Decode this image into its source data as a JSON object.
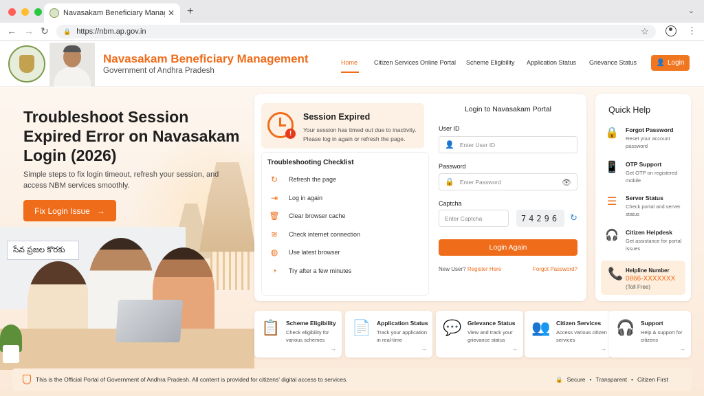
{
  "browser": {
    "tab_title": "Navasakam Beneficiary Management",
    "tab_close": "✕",
    "new_tab": "+",
    "url": "https://nbm.ap.gov.in"
  },
  "header": {
    "title": "Navasakam Beneficiary Management",
    "subtitle": "Government of Andhra Pradesh",
    "nav": [
      "Home",
      "Citizen Services Online Portal",
      "Scheme Eligibility",
      "Application Status",
      "Grievance Status"
    ],
    "login_label": "Login"
  },
  "hero": {
    "title": "Troubleshoot Session Expired Error on Navasakam Login (2026)",
    "subtitle": "Simple steps to fix login timeout, refresh your session, and access NBM services smoothly.",
    "cta_label": "Fix Login Issue",
    "sign_text": "సేవ ప్రజల కొరకు"
  },
  "expired": {
    "title": "Session Expired",
    "message": "Your session has timed out due to inactivity. Please log in again or refresh the page.",
    "badge": "!"
  },
  "checklist": {
    "title": "Troubleshooting Checklist",
    "items": [
      {
        "icon": "refresh-icon",
        "label": "Refresh the page"
      },
      {
        "icon": "login-icon",
        "label": "Log in again"
      },
      {
        "icon": "trash-icon",
        "label": "Clear browser cache"
      },
      {
        "icon": "wifi-icon",
        "label": "Check internet connection"
      },
      {
        "icon": "globe-icon",
        "label": "Use latest browser"
      },
      {
        "icon": "clock-icon",
        "label": "Try after a few minutes"
      }
    ]
  },
  "login_form": {
    "title": "Login to Navasakam Portal",
    "user_label": "User ID",
    "user_placeholder": "Enter User ID",
    "password_label": "Password",
    "password_placeholder": "Enter Password",
    "captcha_label": "Captcha",
    "captcha_placeholder": "Enter Captcha",
    "captcha_code": "74296",
    "submit_label": "Login Again",
    "new_user_text": "New User?",
    "register_label": "Register Here",
    "forgot_label": "Forgot Password?"
  },
  "quick_help": {
    "title": "Quick Help",
    "items": [
      {
        "title": "Forgot Password",
        "desc": "Reset your account password"
      },
      {
        "title": "OTP Support",
        "desc": "Get OTP on registered mobile"
      },
      {
        "title": "Server Status",
        "desc": "Check portal and server status"
      },
      {
        "title": "Citizen Helpdesk",
        "desc": "Get assistance for portal issues"
      }
    ],
    "helpline_label": "Helpline Number",
    "helpline_number": "0866-XXXXXXX",
    "helpline_note": "(Toll Free)"
  },
  "services": [
    {
      "title": "Scheme Eligibility",
      "desc": "Check eligibility for various schemes"
    },
    {
      "title": "Application Status",
      "desc": "Track your application in real-time"
    },
    {
      "title": "Grievance Status",
      "desc": "View and track your grievance status"
    },
    {
      "title": "Citizen Services",
      "desc": "Access various citizen services"
    },
    {
      "title": "Support",
      "desc": "Help & support for citizens"
    }
  ],
  "footer": {
    "text": "This is the Official Portal of Government of Andhra Pradesh. All content is provided for citizens' digital access to services.",
    "badges": [
      "Secure",
      "•",
      "Transparent",
      "•",
      "Citizen First"
    ]
  },
  "colors": {
    "accent": "#ef6c1a",
    "link_blue": "#2a7fd4"
  }
}
